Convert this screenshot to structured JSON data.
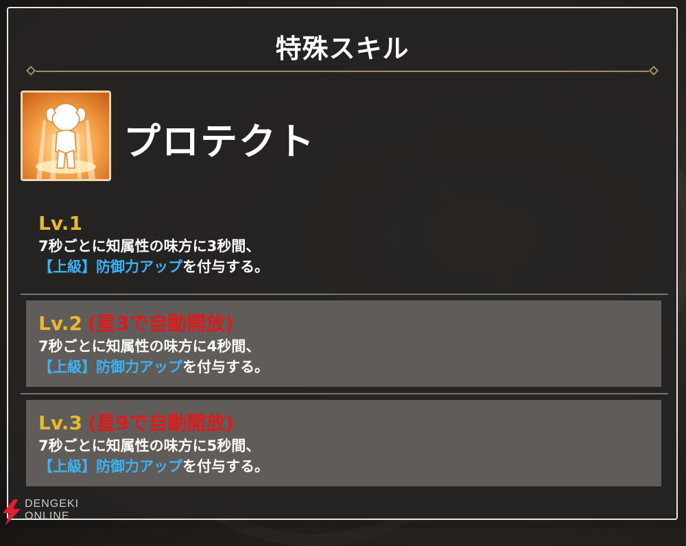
{
  "panel": {
    "title": "特殊スキル"
  },
  "skill": {
    "name": "プロテクト",
    "icon": "protect-pose-icon"
  },
  "levels": [
    {
      "title": "Lv.1",
      "condition": "",
      "desc_line1": "7秒ごとに知属性の味方に3秒間、",
      "buff": "【上級】防御力アップ",
      "desc_suffix": "を付与する。"
    },
    {
      "title": "Lv.2",
      "condition": "(星3で自動開放)",
      "desc_line1": "7秒ごとに知属性の味方に4秒間、",
      "buff": "【上級】防御力アップ",
      "desc_suffix": "を付与する。"
    },
    {
      "title": "Lv.3",
      "condition": "(星9で自動開放)",
      "desc_line1": "7秒ごとに知属性の味方に5秒間、",
      "buff": "【上級】防御力アップ",
      "desc_suffix": "を付与する。"
    }
  ],
  "watermark": {
    "line1": "DENGEKI",
    "line2": "ONLINE"
  },
  "colors": {
    "level_title": "#e8b92d",
    "condition": "#e01a1a",
    "buff": "#3ab3f5",
    "divider": "#a08f62"
  }
}
